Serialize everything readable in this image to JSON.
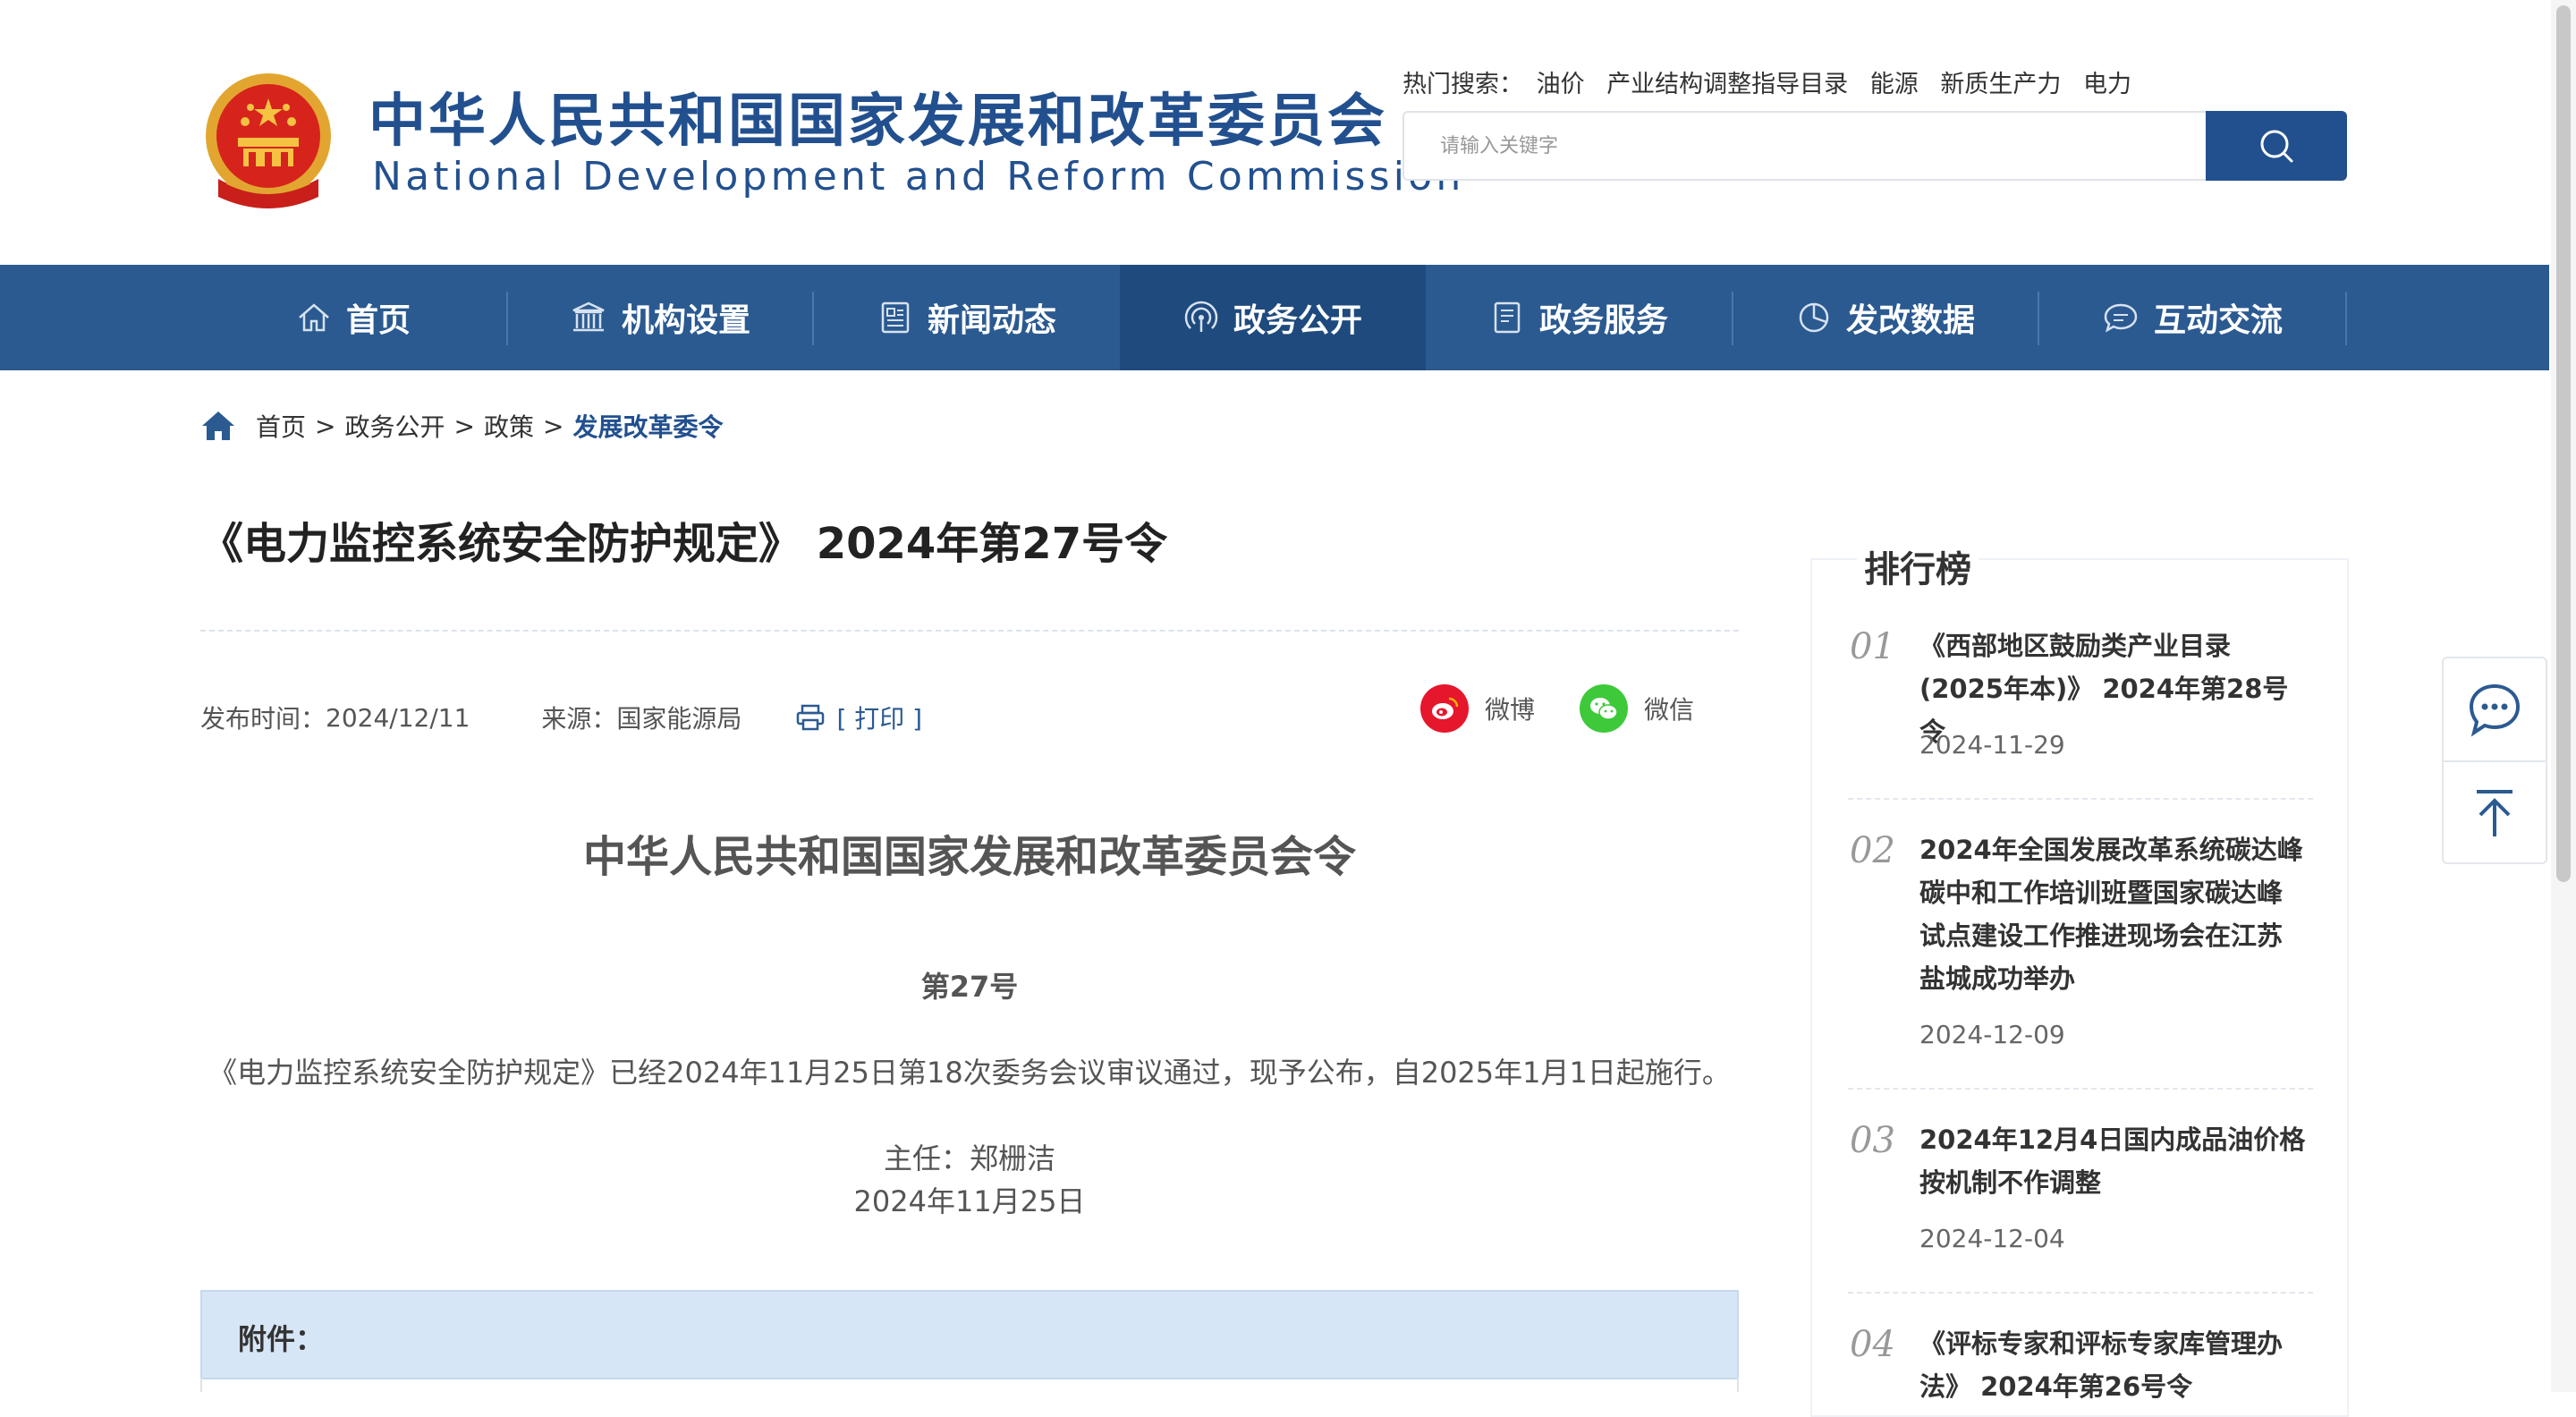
{
  "header": {
    "site_name_cn": "中华人民共和国国家发展和改革委员会",
    "site_name_en": "National Development and Reform Commission",
    "hot_search_label": "热门搜索：",
    "hot_search_items": [
      "油价",
      "产业结构调整指导目录",
      "能源",
      "新质生产力",
      "电力"
    ],
    "search_placeholder": "请输入关键字",
    "search_icon": "search-icon"
  },
  "nav": {
    "items": [
      {
        "label": "首页",
        "icon": "home-icon"
      },
      {
        "label": "机构设置",
        "icon": "building-icon"
      },
      {
        "label": "新闻动态",
        "icon": "news-icon"
      },
      {
        "label": "政务公开",
        "icon": "broadcast-icon",
        "active": true
      },
      {
        "label": "政务服务",
        "icon": "document-icon"
      },
      {
        "label": "发改数据",
        "icon": "pie-chart-icon"
      },
      {
        "label": "互动交流",
        "icon": "chat-icon"
      }
    ]
  },
  "breadcrumb": {
    "items": [
      "首页",
      "政务公开",
      "政策",
      "发展改革委令"
    ],
    "separator": ">"
  },
  "article": {
    "title": "《电力监控系统安全防护规定》 2024年第27号令",
    "publish_label": "发布时间：",
    "publish_date": "2024/12/11",
    "source_label": "来源：",
    "source": "国家能源局",
    "print_label": "[ 打印 ]",
    "share": {
      "weibo": "微博",
      "wechat": "微信"
    },
    "doc_heading": "中华人民共和国国家发展和改革委员会令",
    "doc_number": "第27号",
    "doc_body": "《电力监控系统安全防护规定》已经2024年11月25日第18次委务会议审议通过，现予公布，自2025年1月1日起施行。",
    "signatory": "主任：郑栅洁",
    "sign_date": "2024年11月25日",
    "attachment_label": "附件："
  },
  "ranking": {
    "title": "排行榜",
    "items": [
      {
        "num": "01",
        "lines": [
          "《西部地区鼓励类产业目录",
          "(2025年本)》 2024年第28号令"
        ],
        "date": "2024-11-29"
      },
      {
        "num": "02",
        "lines": [
          "2024年全国发展改革系统碳达峰",
          "碳中和工作培训班暨国家碳达峰",
          "试点建设工作推进现场会在江苏",
          "盐城成功举办"
        ],
        "date": "2024-12-09"
      },
      {
        "num": "03",
        "lines": [
          "2024年12月4日国内成品油价格",
          "按机制不作调整"
        ],
        "date": "2024-12-04"
      },
      {
        "num": "04",
        "lines": [
          "《评标专家和评标专家库管理办",
          "法》 2024年第26号令"
        ],
        "date": ""
      }
    ]
  },
  "float_tools": {
    "chat_icon": "chat-bubble-icon",
    "top_icon": "back-to-top-icon"
  },
  "colors": {
    "brand": "#22508f",
    "nav_bg": "#2b5a91",
    "nav_active": "#1f4a7e",
    "attach_bg": "#d7e6f6",
    "weibo": "#e6162d",
    "wechat": "#3ec93a"
  }
}
